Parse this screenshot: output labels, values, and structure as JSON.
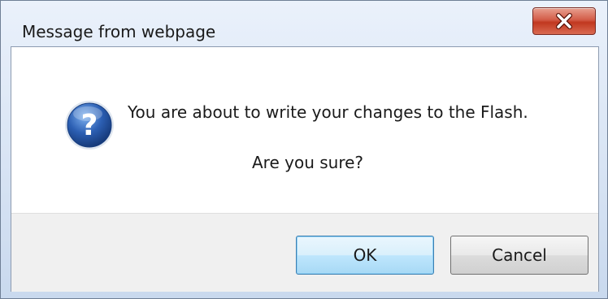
{
  "window": {
    "title": "Message from webpage",
    "close_label": "X"
  },
  "message": {
    "line1": "You are about to write your changes to the Flash.",
    "line2": "Are you sure?",
    "icon": "question-icon"
  },
  "buttons": {
    "ok": "OK",
    "cancel": "Cancel"
  },
  "colors": {
    "accent_blue": "#2c5fb3",
    "close_red": "#c1381f",
    "default_button_border": "#3c7fb1"
  }
}
